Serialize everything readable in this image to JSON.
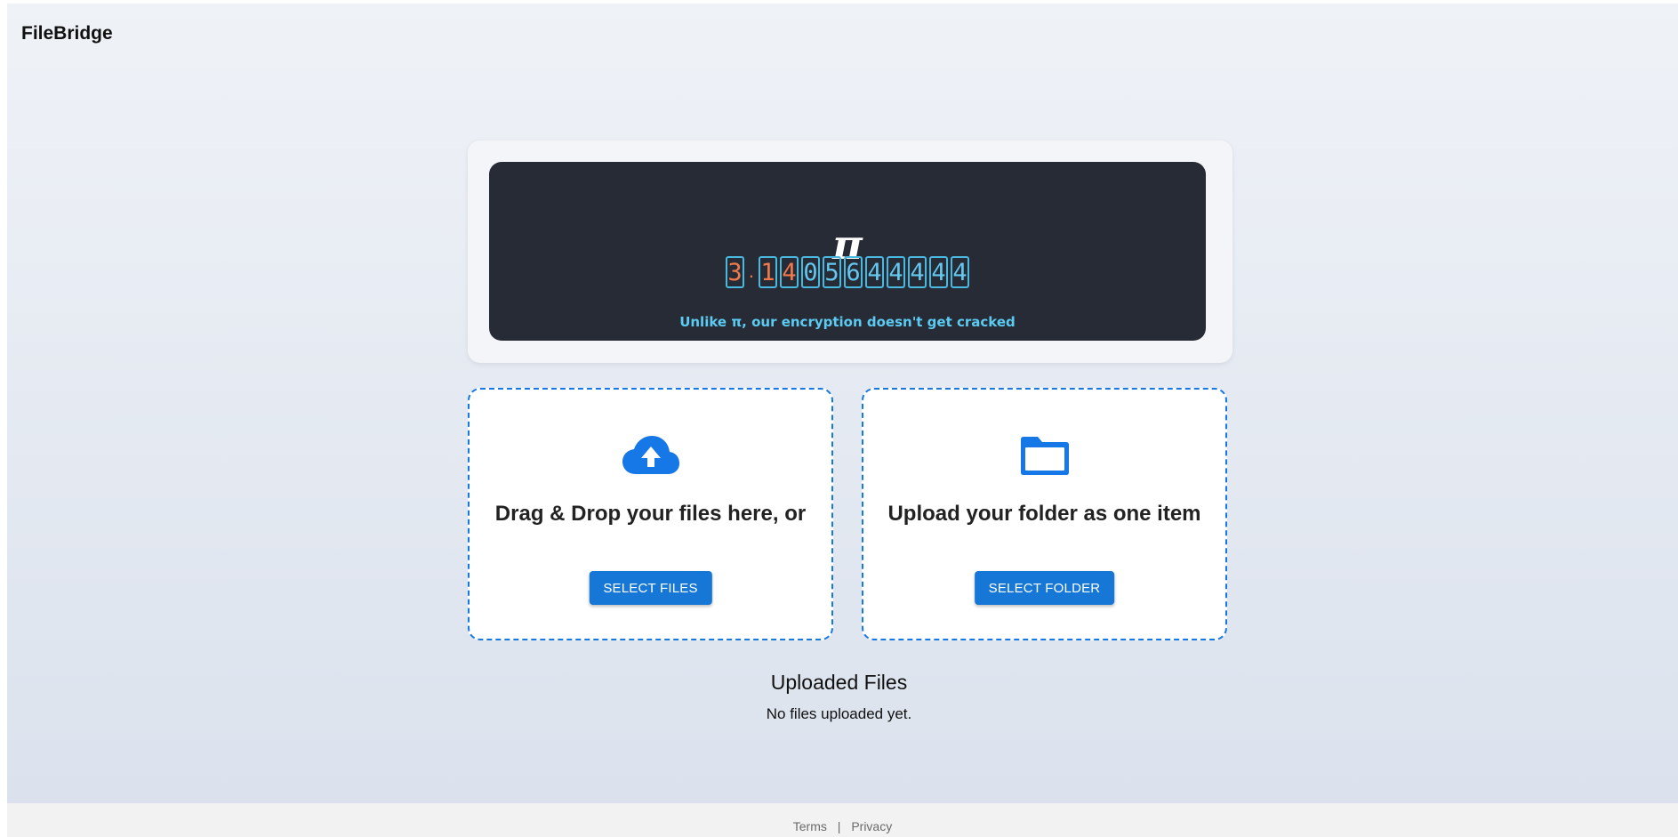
{
  "header": {
    "brand": "FileBridge"
  },
  "pi_banner": {
    "symbol": "π",
    "digits": [
      "3",
      ".",
      "1",
      "4",
      "0",
      "5",
      "6",
      "4",
      "4",
      "4",
      "4",
      "4"
    ],
    "tagline": "Unlike π, our encryption doesn't get cracked",
    "colors": {
      "highlight": "#f07a4b",
      "digit": "#63c7ef",
      "panel": "#272b35"
    }
  },
  "upload_files": {
    "icon": "cloud-upload-icon",
    "heading": "Drag & Drop your files here, or",
    "button_label": "SELECT FILES"
  },
  "upload_folder": {
    "icon": "folder-icon",
    "heading": "Upload your folder as one item",
    "button_label": "SELECT FOLDER"
  },
  "uploaded": {
    "title": "Uploaded Files",
    "empty_text": "No files uploaded yet."
  },
  "footer": {
    "terms_label": "Terms",
    "separator": "|",
    "privacy_label": "Privacy"
  },
  "colors": {
    "accent": "#1677d6",
    "border": "#1677e6"
  }
}
